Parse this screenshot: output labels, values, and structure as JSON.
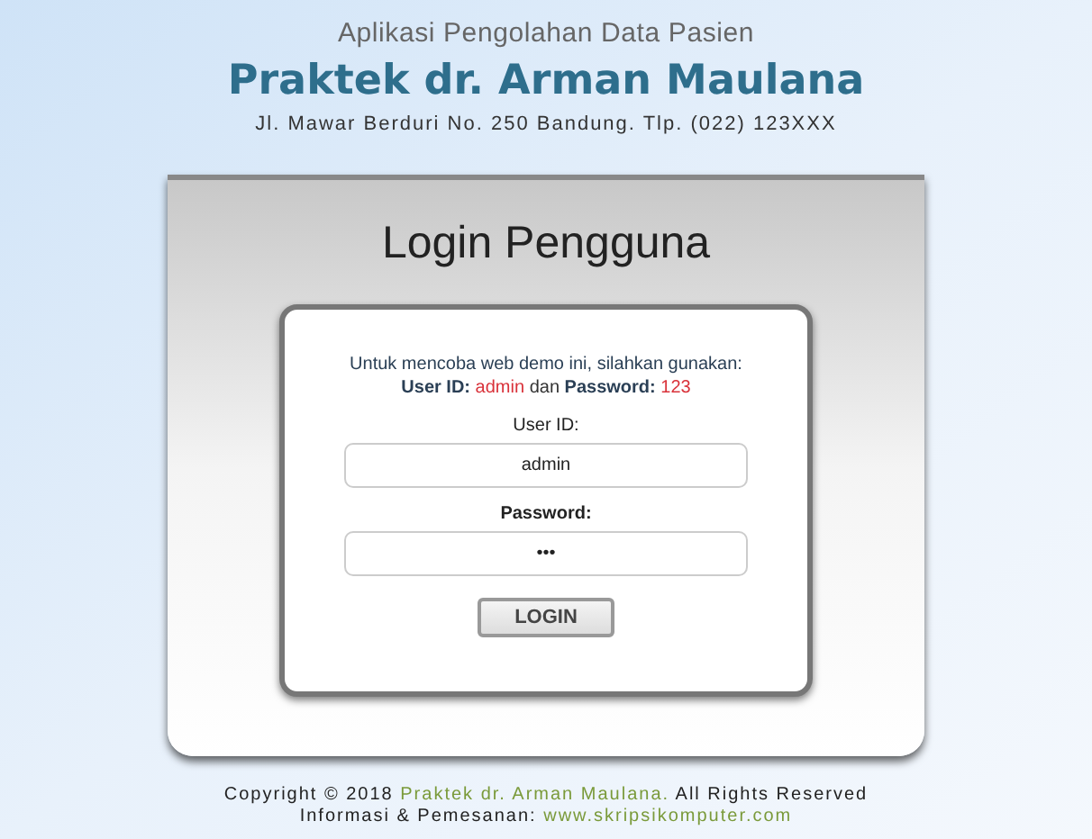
{
  "header": {
    "subtitle": "Aplikasi Pengolahan Data Pasien",
    "title": "Praktek dr. Arman Maulana",
    "address": "Jl. Mawar Berduri No. 250 Bandung. Tlp. (022) 123XXX"
  },
  "login": {
    "heading": "Login Pengguna",
    "intro": "Untuk mencoba web demo ini, silahkan gunakan:",
    "hint": [
      {
        "text": "User ID:",
        "kind": "label"
      },
      {
        "text": "admin",
        "kind": "value"
      },
      {
        "text": "dan",
        "kind": "plain"
      },
      {
        "text": "Password:",
        "kind": "label"
      },
      {
        "text": "123",
        "kind": "value"
      }
    ],
    "fields": [
      {
        "label": "User ID:",
        "value": "admin",
        "bold": false
      },
      {
        "label": "Password:",
        "value": "•••",
        "bold": true
      }
    ],
    "button": "LOGIN"
  },
  "footer": [
    [
      {
        "text": "Copyright © 2018",
        "kind": "plain"
      },
      {
        "text": "Praktek dr. Arman Maulana.",
        "kind": "link"
      },
      {
        "text": "All Rights Reserved",
        "kind": "plain"
      }
    ],
    [
      {
        "text": "Informasi & Pemesanan:",
        "kind": "plain"
      },
      {
        "text": "www.skripsikomputer.com",
        "kind": "link"
      }
    ]
  ]
}
